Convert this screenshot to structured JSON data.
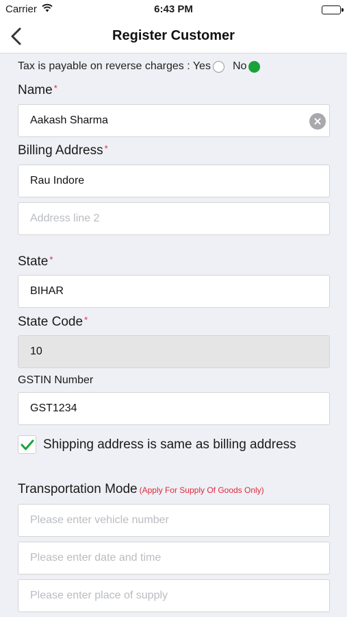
{
  "status_bar": {
    "carrier": "Carrier",
    "time": "6:43 PM",
    "battery_level": 1.0
  },
  "nav": {
    "title": "Register Customer",
    "back_icon": "chevron-left-icon"
  },
  "reverse_charge": {
    "label": "Tax is payable on reverse charges : Yes",
    "no_label": "No",
    "selected": "No",
    "selected_color": "#1aa23a"
  },
  "name": {
    "label": "Name",
    "required_mark": "*",
    "value": "Aakash Sharma"
  },
  "billing_address": {
    "label": "Billing Address",
    "required_mark": "*",
    "line1": "Rau Indore",
    "line2_placeholder": "Address line 2"
  },
  "state": {
    "label": "State",
    "required_mark": "*",
    "value": "BIHAR"
  },
  "state_code": {
    "label": "State Code",
    "required_mark": "*",
    "value": "10"
  },
  "gstin": {
    "label": "GSTIN Number",
    "value": "GST1234"
  },
  "shipping_same": {
    "label": "Shipping address is same as billing address",
    "checked": true,
    "check_color": "#1aa23a"
  },
  "transportation": {
    "label": "Transportation Mode",
    "note": "(Apply For Supply Of Goods Only)",
    "vehicle_placeholder": "Please enter vehicle number",
    "datetime_placeholder": "Please enter date and time",
    "place_placeholder": "Please enter place of supply"
  },
  "colors": {
    "required": "#e0283a",
    "background": "#eef0f5"
  }
}
